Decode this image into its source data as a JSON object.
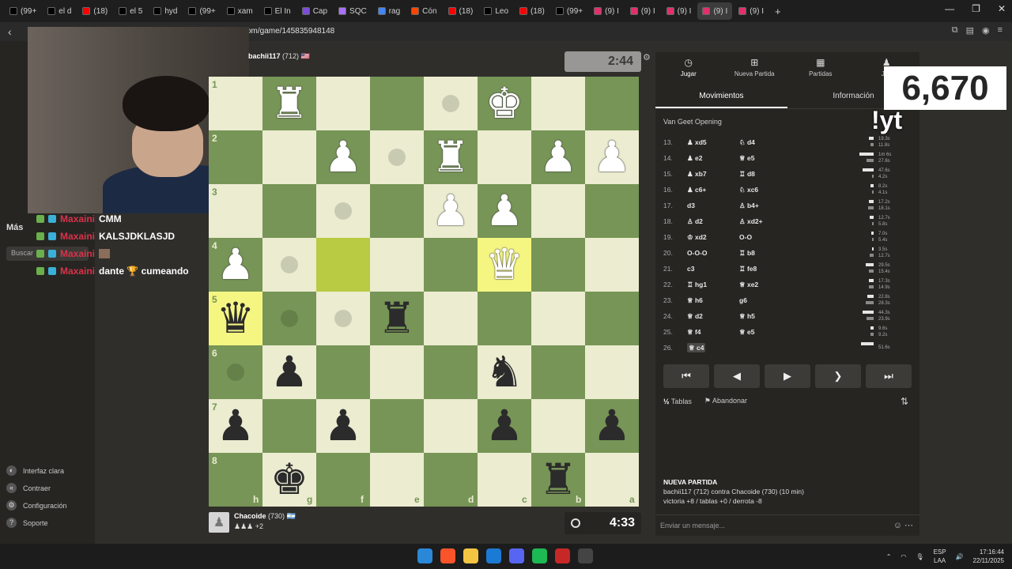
{
  "browser": {
    "tabs": [
      {
        "label": "(99+",
        "color": "#000000"
      },
      {
        "label": "el d",
        "color": "#000000"
      },
      {
        "label": "(18)",
        "color": "#ff0000"
      },
      {
        "label": "el 5",
        "color": "#000000"
      },
      {
        "label": "hyd",
        "color": "#000000"
      },
      {
        "label": "(99+",
        "color": "#000000"
      },
      {
        "label": "xam",
        "color": "#000000"
      },
      {
        "label": "El In",
        "color": "#000000"
      },
      {
        "label": "Cap",
        "color": "#7b4dd8"
      },
      {
        "label": "SQC",
        "color": "#a970ff"
      },
      {
        "label": "rag",
        "color": "#4285f4"
      },
      {
        "label": "Cón",
        "color": "#ff4500"
      },
      {
        "label": "(18)",
        "color": "#ff0000"
      },
      {
        "label": "Leo",
        "color": "#000000"
      },
      {
        "label": "(18)",
        "color": "#ff0000"
      },
      {
        "label": "(99+",
        "color": "#000000"
      },
      {
        "label": "(9) I",
        "color": "#e1306c"
      },
      {
        "label": "(9) I",
        "color": "#e1306c"
      },
      {
        "label": "(9) I",
        "color": "#e1306c"
      },
      {
        "label": "(9) I",
        "color": "#e1306c"
      },
      {
        "label": "(9) I",
        "color": "#e1306c"
      }
    ],
    "url": "om/game/145835948148",
    "new_tab": "+",
    "window_controls": [
      "—",
      "❐",
      "✕"
    ]
  },
  "sidebar": {
    "more_label": "Más",
    "search_placeholder": "Buscar",
    "bottom_items": [
      {
        "label": "Interfaz clara",
        "icon": "theme-icon"
      },
      {
        "label": "Contraer",
        "icon": "collapse-icon"
      },
      {
        "label": "Configuración",
        "icon": "gear-icon"
      },
      {
        "label": "Soporte",
        "icon": "help-icon"
      }
    ]
  },
  "chat_overlay": [
    {
      "user": "Maxaini",
      "message": "CMM"
    },
    {
      "user": "Maxaini",
      "message": "KALSJDKLASJD"
    },
    {
      "user": "Maxaini",
      "message": ""
    },
    {
      "user": "Maxaini",
      "message": "dante 🏆 cumeando"
    }
  ],
  "game": {
    "top_player": {
      "name": "bachii117",
      "rating": "(712)",
      "flag": "🇺🇸",
      "clock": "2:44"
    },
    "bottom_player": {
      "name": "Chacoide",
      "rating": "(730)",
      "flag": "🇦🇷",
      "clock": "4:33",
      "material": "+2"
    },
    "ranks": [
      "1",
      "2",
      "3",
      "4",
      "5",
      "6",
      "7",
      "8"
    ],
    "files": [
      "h",
      "g",
      "f",
      "e",
      "d",
      "c",
      "b",
      "a"
    ]
  },
  "board": {
    "pieces": [
      {
        "sq": "g1",
        "p": "♜",
        "c": "w"
      },
      {
        "sq": "c1",
        "p": "♚",
        "c": "w"
      },
      {
        "sq": "f2",
        "p": "♟",
        "c": "w"
      },
      {
        "sq": "d2",
        "p": "♜",
        "c": "w"
      },
      {
        "sq": "b2",
        "p": "♟",
        "c": "w"
      },
      {
        "sq": "a2",
        "p": "♟",
        "c": "w"
      },
      {
        "sq": "d3",
        "p": "♟",
        "c": "w"
      },
      {
        "sq": "c3",
        "p": "♟",
        "c": "w"
      },
      {
        "sq": "h4",
        "p": "♟",
        "c": "w"
      },
      {
        "sq": "c4",
        "p": "♛",
        "c": "w"
      },
      {
        "sq": "h5",
        "p": "♛",
        "c": "b"
      },
      {
        "sq": "e5",
        "p": "♜",
        "c": "b"
      },
      {
        "sq": "g6",
        "p": "♟",
        "c": "b"
      },
      {
        "sq": "c6",
        "p": "♞",
        "c": "b"
      },
      {
        "sq": "h7",
        "p": "♟",
        "c": "b"
      },
      {
        "sq": "f7",
        "p": "♟",
        "c": "b"
      },
      {
        "sq": "c7",
        "p": "♟",
        "c": "b"
      },
      {
        "sq": "a7",
        "p": "♟",
        "c": "b"
      },
      {
        "sq": "g8",
        "p": "♚",
        "c": "b"
      },
      {
        "sq": "b8",
        "p": "♜",
        "c": "b"
      }
    ],
    "highlighted": [
      "c4",
      "h5"
    ],
    "last_move_from": "f4",
    "hints": [
      "d1",
      "e2",
      "f3",
      "g4",
      "g5",
      "f5",
      "h6"
    ]
  },
  "panel": {
    "tabs": [
      {
        "label": "Jugar",
        "icon": "clock-icon"
      },
      {
        "label": "Nueva Partida",
        "icon": "plus-icon"
      },
      {
        "label": "Partidas",
        "icon": "board-icon"
      },
      {
        "label": "Jug",
        "icon": "players-icon"
      }
    ],
    "subtabs": [
      "Movimientos",
      "Información"
    ],
    "opening": "Van Geet Opening",
    "moves": [
      {
        "n": "13.",
        "w": "♟ xd5",
        "b": "♘ d4",
        "t1": "19.3s",
        "t2": "11.8s",
        "b1": 6,
        "b2": 4
      },
      {
        "n": "14.",
        "w": "♟ e2",
        "b": "♕ e5",
        "t1": "1m 6s",
        "t2": "27.6s",
        "b1": 18,
        "b2": 9
      },
      {
        "n": "15.",
        "w": "♟ xb7",
        "b": "♖ d8",
        "t1": "47.6s",
        "t2": "4.2s",
        "b1": 14,
        "b2": 2
      },
      {
        "n": "16.",
        "w": "♟ c6+",
        "b": "♘ xc6",
        "t1": "8.2s",
        "t2": "4.1s",
        "b1": 4,
        "b2": 2
      },
      {
        "n": "17.",
        "w": "d3",
        "b": "♙ b4+",
        "t1": "17.2s",
        "t2": "18.1s",
        "b1": 6,
        "b2": 7
      },
      {
        "n": "18.",
        "w": "♙ d2",
        "b": "♙ xd2+",
        "t1": "12.7s",
        "t2": "5.8s",
        "b1": 5,
        "b2": 2
      },
      {
        "n": "19.",
        "w": "♔ xd2",
        "b": "O-O",
        "t1": "7.0s",
        "t2": "5.4s",
        "b1": 3,
        "b2": 2
      },
      {
        "n": "20.",
        "w": "O-O-O",
        "b": "♖ b8",
        "t1": "3.5s",
        "t2": "12.7s",
        "b1": 2,
        "b2": 5
      },
      {
        "n": "21.",
        "w": "c3",
        "b": "♖ fe8",
        "t1": "29.5s",
        "t2": "15.4s",
        "b1": 10,
        "b2": 6
      },
      {
        "n": "22.",
        "w": "♖ hg1",
        "b": "♕ xe2",
        "t1": "17.3s",
        "t2": "14.9s",
        "b1": 6,
        "b2": 6
      },
      {
        "n": "23.",
        "w": "♕ h6",
        "b": "g6",
        "t1": "22.8s",
        "t2": "28.3s",
        "b1": 8,
        "b2": 10
      },
      {
        "n": "24.",
        "w": "♕ d2",
        "b": "♕ h5",
        "t1": "44.3s",
        "t2": "23.9s",
        "b1": 14,
        "b2": 9
      },
      {
        "n": "25.",
        "w": "♕ f4",
        "b": "♕ e5",
        "t1": "9.6s",
        "t2": "9.2s",
        "b1": 4,
        "b2": 4
      },
      {
        "n": "26.",
        "w": "♕ c4",
        "b": "",
        "t1": "51.6s",
        "t2": "",
        "b1": 16,
        "b2": 0
      }
    ],
    "nav_buttons": [
      "⏮",
      "◀",
      "▶",
      "▶",
      "⏭"
    ],
    "draw_label": "Tablas",
    "resign_label": "Abandonar",
    "draw_icon": "½",
    "new_game_title": "NUEVA PARTIDA",
    "new_game_line1": "bachii117 (712) contra Chacoide (730) (10 min)",
    "new_game_line2": "victoria +8 / tablas +0 / derrota -8",
    "message_placeholder": "Enviar un mensaje..."
  },
  "overlay": {
    "counter": "6,670",
    "yt": "!yt"
  },
  "taskbar": {
    "lang": "ESP",
    "lang2": "LAA",
    "time": "17:16:44",
    "date": "22/11/2025",
    "icons": [
      {
        "name": "windows-start-icon",
        "color": "#2b88d8"
      },
      {
        "name": "brave-icon",
        "color": "#fb542b"
      },
      {
        "name": "file-explorer-icon",
        "color": "#f4c542"
      },
      {
        "name": "bing-icon",
        "color": "#1b7ad3"
      },
      {
        "name": "discord-icon",
        "color": "#5865f2"
      },
      {
        "name": "spotify-icon",
        "color": "#1db954"
      },
      {
        "name": "streaming-app-icon",
        "color": "#c62828"
      },
      {
        "name": "obs-icon",
        "color": "#444444"
      }
    ]
  }
}
